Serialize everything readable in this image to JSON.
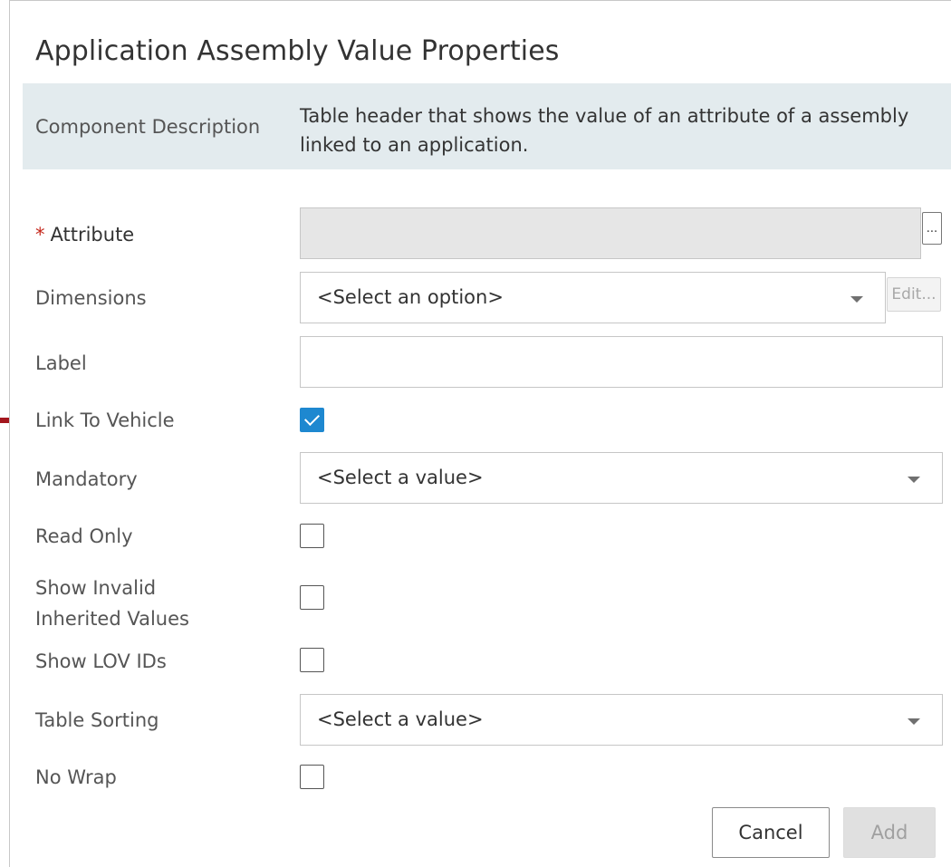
{
  "dialog": {
    "title": "Application Assembly Value Properties",
    "description_label": "Component Description",
    "description_text": "Table header that shows the value of an attribute of a assembly linked to an application."
  },
  "fields": {
    "attribute": {
      "required_mark": "*",
      "label": "Attribute",
      "value": "",
      "browse_button": "..."
    },
    "dimensions": {
      "label": "Dimensions",
      "selected": "<Select an option>",
      "edit_button": "Edit..."
    },
    "label": {
      "label": "Label",
      "value": ""
    },
    "link_to_vehicle": {
      "label": "Link To Vehicle",
      "checked": true
    },
    "mandatory": {
      "label": "Mandatory",
      "selected": "<Select a value>"
    },
    "read_only": {
      "label": "Read Only",
      "checked": false
    },
    "show_invalid_inherited_values": {
      "label_line1": "Show Invalid",
      "label_line2": "Inherited Values",
      "checked": false
    },
    "show_lov_ids": {
      "label": "Show LOV IDs",
      "checked": false
    },
    "table_sorting": {
      "label": "Table Sorting",
      "selected": "<Select a value>"
    },
    "no_wrap": {
      "label": "No Wrap",
      "checked": false
    }
  },
  "buttons": {
    "cancel": "Cancel",
    "add": "Add"
  },
  "colors": {
    "accent": "#1e88d0",
    "required": "#c5281c",
    "panel_bg": "#e3ebee",
    "arrow": "#a3161d"
  },
  "icons": {
    "pointer": "arrow-right-icon",
    "checkmark": "checkmark-icon",
    "dropdown": "chevron-down-icon"
  }
}
